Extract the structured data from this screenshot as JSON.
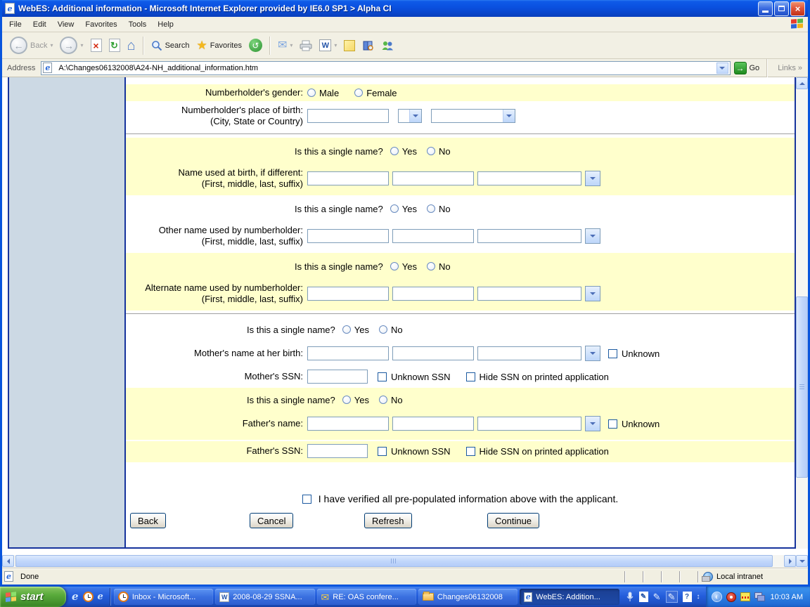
{
  "colors": {
    "highlight_row": "#FFFFCC",
    "frame_panel": "#CCD9E4",
    "frame_border": "#16339C",
    "titlebar_blue": "#0A51E0",
    "taskbar_blue": "#245EDC",
    "input_border": "#7F9DB9"
  },
  "window": {
    "title": "WebES: Additional information - Microsoft Internet Explorer provided by IE6.0 SP1 > Alpha CI",
    "menu": [
      "File",
      "Edit",
      "View",
      "Favorites",
      "Tools",
      "Help"
    ],
    "toolbar": {
      "back_label": "Back",
      "search_label": "Search",
      "favorites_label": "Favorites"
    },
    "address": {
      "label": "Address",
      "value": "A:\\Changes06132008\\A24-NH_additional_information.htm",
      "go_label": "Go",
      "links_label": "Links"
    }
  },
  "icons": {
    "stop": "×",
    "refresh": "↻",
    "home": "⌂",
    "star": "★",
    "history": "↺",
    "mail": "✉",
    "back_arrow": "←",
    "forward_arrow": "→",
    "dropdown": "▾",
    "word": "W",
    "ie": "e",
    "links_chevron": "»",
    "go_arrow": "→",
    "pencil": "✎",
    "question": "?",
    "updown": "↕",
    "tray_chevron": "‹"
  },
  "form": {
    "gender": {
      "label": "Numberholder's gender:",
      "male": "Male",
      "female": "Female",
      "selected": null
    },
    "pob": {
      "label": "Numberholder's place of birth:",
      "sublabel": "(City, State or Country)",
      "city_value": "",
      "state_value": "",
      "country_value": ""
    },
    "single_question": "Is this a single name?",
    "yes": "Yes",
    "no": "No",
    "name_sections": [
      {
        "label": "Name used at birth, if different:",
        "sublabel": "(First, middle, last, suffix)",
        "single_selected": null,
        "values": [
          "",
          "",
          ""
        ],
        "suffix_value": ""
      },
      {
        "label": "Other name used by numberholder:",
        "sublabel": "(First, middle, last, suffix)",
        "single_selected": null,
        "values": [
          "",
          "",
          ""
        ],
        "suffix_value": ""
      },
      {
        "label": "Alternate name used by numberholder:",
        "sublabel": "(First, middle, last, suffix)",
        "single_selected": null,
        "values": [
          "",
          "",
          ""
        ],
        "suffix_value": ""
      }
    ],
    "mother": {
      "name_label": "Mother's name at her birth:",
      "unknown_label": "Unknown",
      "ssn_label": "Mother's SSN:",
      "unknown_ssn_label": "Unknown SSN",
      "hide_ssn_label": "Hide SSN on printed application",
      "single_selected": null,
      "values": [
        "",
        "",
        ""
      ],
      "suffix_value": "",
      "ssn_value": "",
      "unknown_checked": false,
      "unknown_ssn_checked": false,
      "hide_ssn_checked": false
    },
    "father": {
      "name_label": "Father's name:",
      "unknown_label": "Unknown",
      "ssn_label": "Father's SSN:",
      "unknown_ssn_label": "Unknown SSN",
      "hide_ssn_label": "Hide SSN on printed application",
      "single_selected": null,
      "values": [
        "",
        "",
        ""
      ],
      "suffix_value": "",
      "ssn_value": "",
      "unknown_checked": false,
      "unknown_ssn_checked": false,
      "hide_ssn_checked": false
    },
    "verify_label": "I have verified all pre-populated information above with the applicant.",
    "verify_checked": false,
    "actions": {
      "back": "Back",
      "cancel": "Cancel",
      "refresh": "Refresh",
      "continue": "Continue"
    }
  },
  "statusbar": {
    "status": "Done",
    "zone": "Local intranet"
  },
  "taskbar": {
    "start_label": "start",
    "tasks": [
      {
        "icon": "clock-icon",
        "label": "Inbox - Microsoft..."
      },
      {
        "icon": "word-icon",
        "label": "2008-08-29 SSNA..."
      },
      {
        "icon": "mail-icon",
        "label": "RE: OAS confere..."
      },
      {
        "icon": "folder-icon",
        "label": "Changes06132008"
      },
      {
        "icon": "ie-icon",
        "label": "WebES: Addition...",
        "active": true
      }
    ],
    "clock": "10:03 AM"
  }
}
